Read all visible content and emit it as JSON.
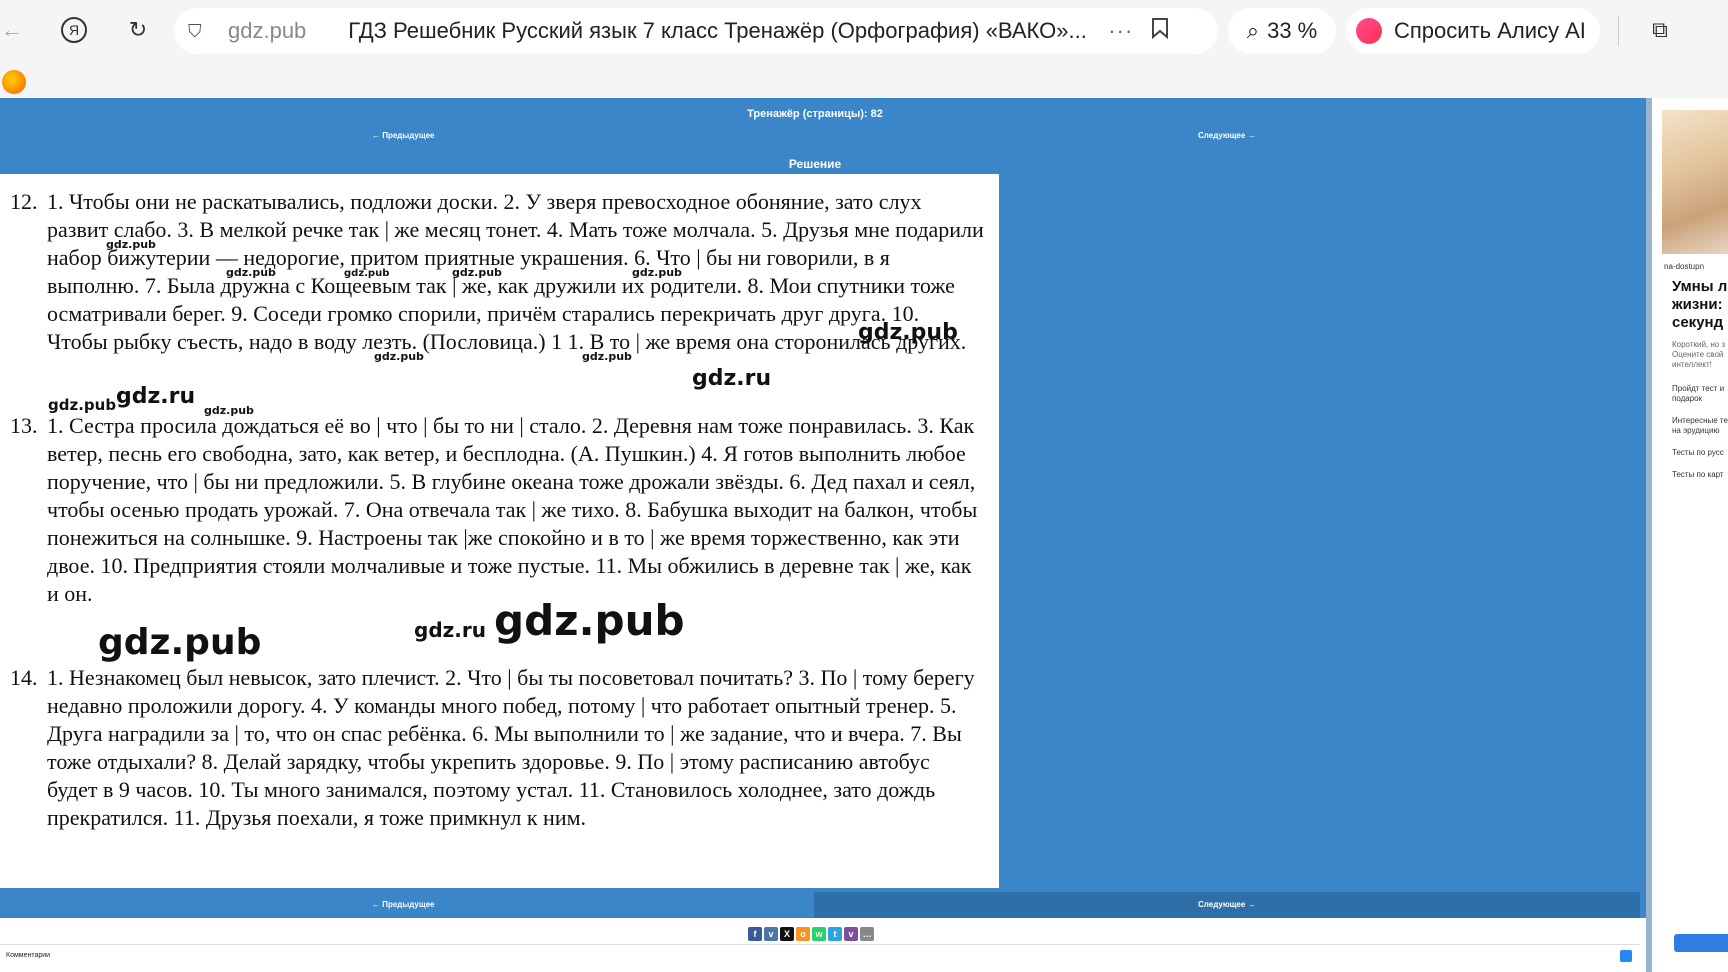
{
  "browser": {
    "domain": "gdz.pub",
    "tab_title": "ГДЗ Решебник Русский язык 7 класс Тренажёр (Орфография) «ВАКО»...",
    "more": "···",
    "zoom": "33 %",
    "alice_label": "Спросить Алису AI",
    "icons": [
      "back-arrow-icon",
      "yandex-icon",
      "reload-icon",
      "shield-icon",
      "bookmark-icon",
      "search-zoom-icon",
      "alice-icon",
      "copy-icon"
    ]
  },
  "page": {
    "header": "Тренажёр (страницы): 82",
    "prev": "← Предыдущее",
    "next": "Следующее →",
    "solution_label": "Решение",
    "items": [
      {
        "num": "12.",
        "text": "1. Чтобы они не раскатывались, подложи доски. 2. У зверя превосходное обоняние, зато слух развит слабо. 3. В мелкой речке так | же месяц тонет. 4. Мать тоже молчала. 5. Друзья мне подарили набор бижутерии — недорогие, притом приятные украшения. 6. Что | бы ни говорили, в я выполню. 7. Была дружна с Кощеевым так | же, как дружили их родители. 8. Мои спутники тоже осматривали берег. 9. Соседи громко спорили, причём старались перекричать друг друга. 10. Чтобы рыбку съесть, надо в воду лезть. (Пословица.) 1 1. В то | же время она сторонилась других."
      },
      {
        "num": "13.",
        "text": "1. Сестра просила дождаться её во | что  | бы то ни | стало. 2. Деревня нам тоже понравилась. 3. Как ветер, песнь его свободна, зато, как ветер, и бесплодна. (А. Пушкин.) 4. Я готов выполнить любое поручение, что | бы ни предложили. 5. В глубине океана тоже дрожали звёзды. 6. Дед пахал и сеял, чтобы осенью продать урожай. 7. Она отвечала так | же тихо. 8. Бабушка выходит на балкон, чтобы понежиться на солнышке. 9. Настроены так |же спокойно и в то | же время торжественно, как эти двое. 10. Предприятия стояли молчаливые и тоже пустые. 11. Мы обжились в деревне так | же, как и он."
      },
      {
        "num": "14.",
        "text": "1. Незнакомец был невысок, зато плечист. 2. Что | бы ты посоветовал почитать? 3. По | тому берегу недавно проложили дорогу. 4. У команды много побед, потому | что работает опытный тренер. 5. Друга наградили за | то, что он спас ребёнка. 6. Мы выполнили то | же задание, что и вчера. 7. Вы тоже отдыхали? 8. Делай зарядку, чтобы укрепить здоровье. 9. По | этому расписанию автобус будет в 9 часов. 10. Ты много занимался, поэтому устал. 11. Становилось холоднее, зато дождь прекратился. 11. Друзья поехали, я тоже примкнул к ним."
      }
    ],
    "watermark_pub": "gdz.pub",
    "watermark_ru": "gdz.ru",
    "share_icons": [
      "facebook-icon",
      "vk-icon",
      "x-icon",
      "ok-icon",
      "whatsapp-icon",
      "telegram-icon",
      "viber-icon",
      "more-share-icon"
    ],
    "comments_label": "Комментарии"
  },
  "ad": {
    "source": "na-dostupn",
    "headline_1": "Умны ли",
    "headline_2": "жизни:",
    "headline_3": "секунд",
    "sub_1": "Короткий, но з",
    "sub_2": "Оцените свой",
    "sub_3": "интеллект!",
    "link_1": "Пройдт тест и",
    "link_1b": "подарок",
    "link_2": "Интересные те",
    "link_2b": "на эрудицию",
    "link_3": "Тесты по русс",
    "link_4": "Тесты по карт"
  },
  "colors": {
    "page_blue": "#3a86c8",
    "dark_blue": "#2f6fa8",
    "chrome_bg": "#f4f5f7"
  }
}
